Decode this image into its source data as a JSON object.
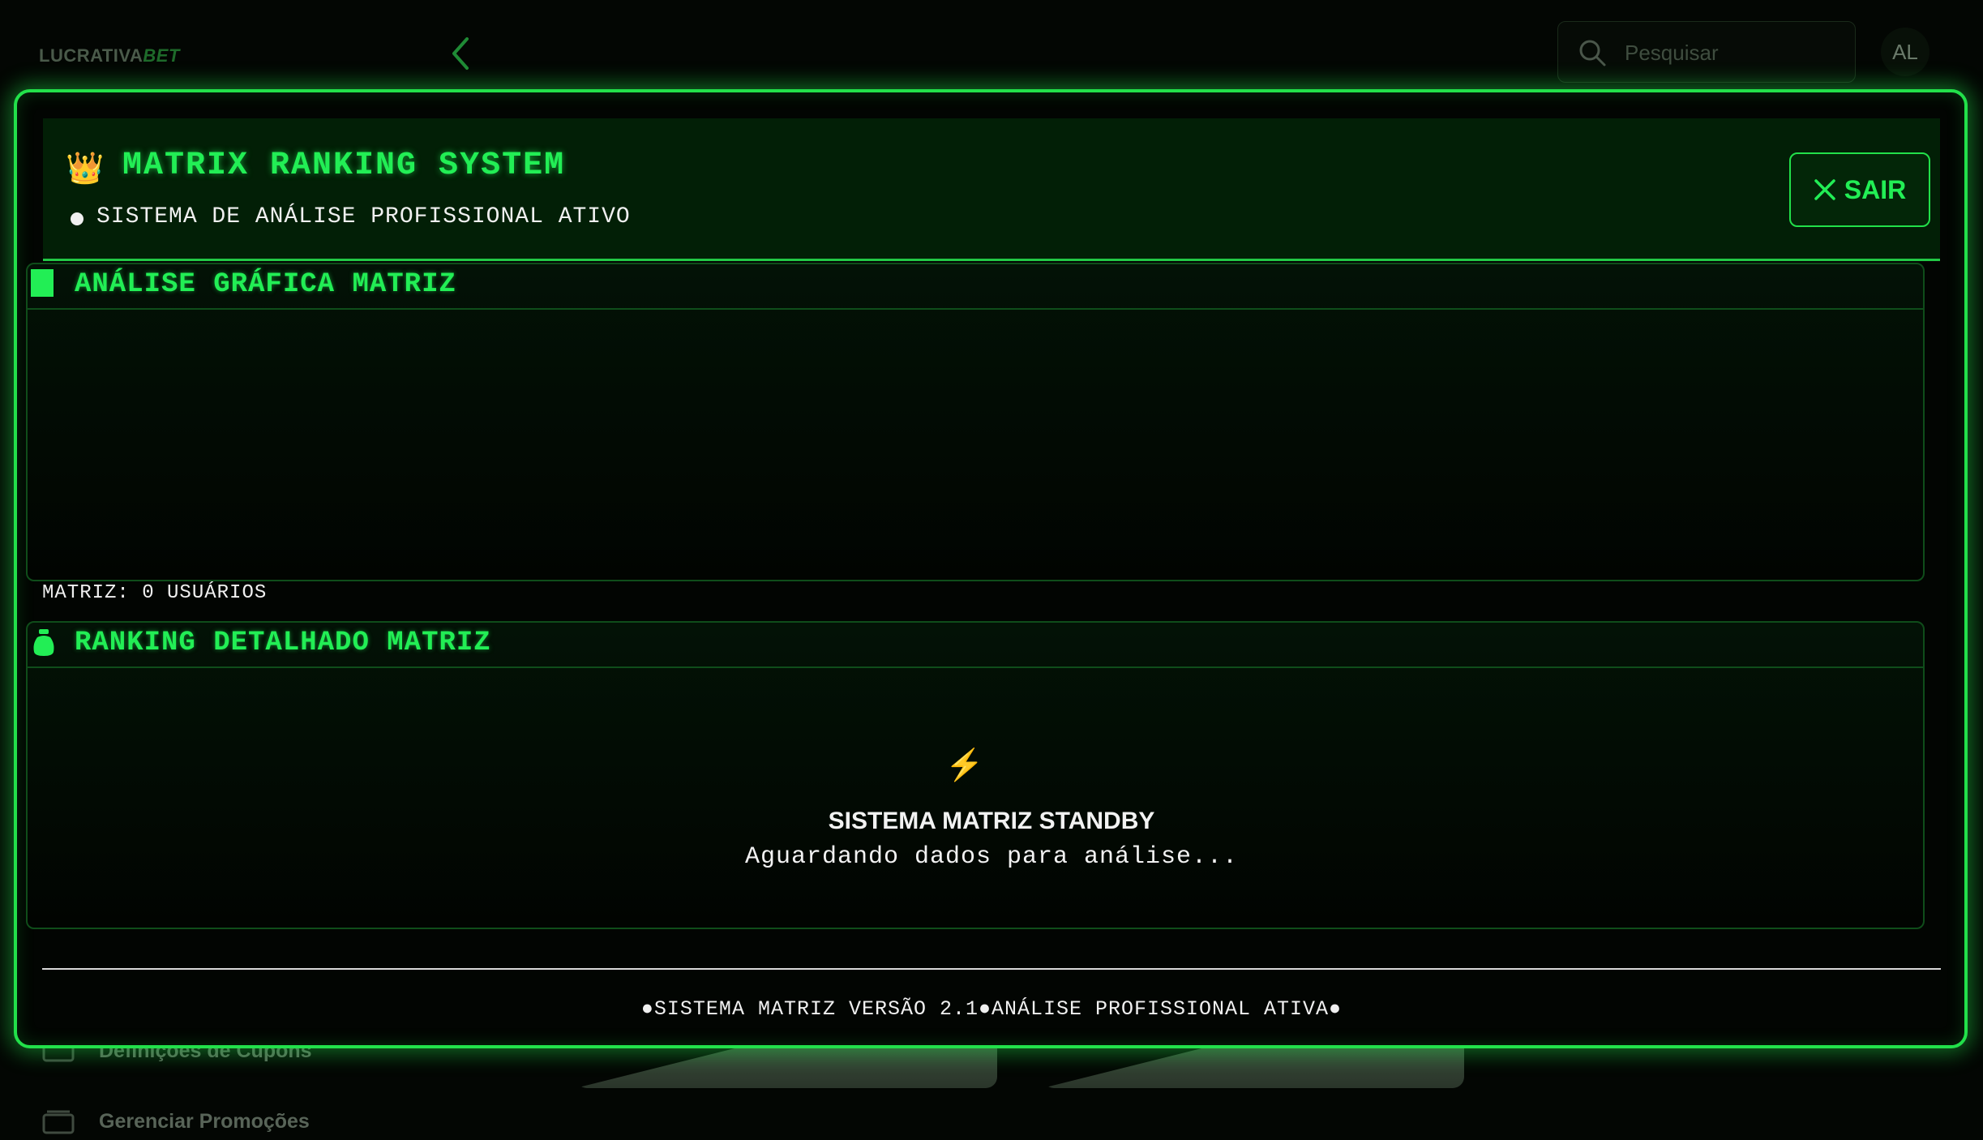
{
  "background": {
    "logo": {
      "text": "LUCRATIVA",
      "accent": "BET"
    },
    "search": {
      "placeholder": "Pesquisar"
    },
    "avatar": {
      "initials": "AL"
    },
    "menu": [
      {
        "label": "Definições de Cupons",
        "icon": "ticket-icon"
      },
      {
        "label": "Gerenciar Promoções",
        "icon": "wallet-icon"
      }
    ]
  },
  "modal": {
    "header": {
      "icon": "👑",
      "title": "MATRIX RANKING SYSTEM",
      "subtitle": "SISTEMA DE ANÁLISE PROFISSIONAL ATIVO",
      "exit_label": "SAIR"
    },
    "chart_panel": {
      "title": "ANÁLISE GRÁFICA MATRIZ"
    },
    "users_count": "MATRIZ: 0 USUÁRIOS",
    "ranking_panel": {
      "title": "RANKING DETALHADO MATRIZ",
      "empty_icon": "⚡",
      "empty_title": "SISTEMA MATRIZ STANDBY",
      "empty_message": "Aguardando dados para análise..."
    },
    "footer": "●SISTEMA MATRIZ VERSÃO 2.1●ANÁLISE PROFISSIONAL ATIVA●"
  },
  "colors": {
    "accent": "#22ee55",
    "border": "#22e04a",
    "background": "#020502",
    "bolt": "#f2c21b"
  }
}
